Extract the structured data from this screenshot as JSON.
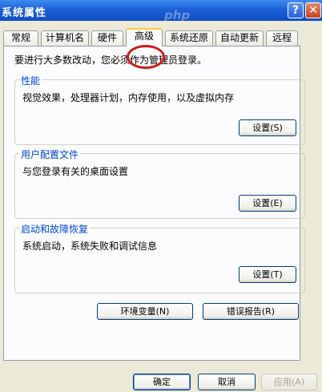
{
  "window": {
    "title": "系统属性",
    "help_glyph": "?",
    "close_glyph": "✕",
    "watermark": "php"
  },
  "tabs": [
    {
      "label": "常规",
      "active": false
    },
    {
      "label": "计算机名",
      "active": false
    },
    {
      "label": "硬件",
      "active": false
    },
    {
      "label": "高级",
      "active": true
    },
    {
      "label": "系统还原",
      "active": false
    },
    {
      "label": "自动更新",
      "active": false
    },
    {
      "label": "远程",
      "active": false
    }
  ],
  "panel": {
    "notice": "要进行大多数改动，您必须作为管理员登录。",
    "groups": [
      {
        "title": "性能",
        "description": "视觉效果，处理器计划，内存使用，以及虚拟内存",
        "button": "设置(S)"
      },
      {
        "title": "用户配置文件",
        "description": "与您登录有关的桌面设置",
        "button": "设置(E)"
      },
      {
        "title": "启动和故障恢复",
        "description": "系统启动，系统失败和调试信息",
        "button": "设置(T)"
      }
    ],
    "env_button": "环境变量(N)",
    "error_button": "错误报告(R)"
  },
  "footer": {
    "ok": "确定",
    "cancel": "取消",
    "apply": "应用(A)"
  },
  "colors": {
    "titlebar": "#0f4ec4",
    "group_title": "#0046d5",
    "annotation": "#d11a1a"
  }
}
